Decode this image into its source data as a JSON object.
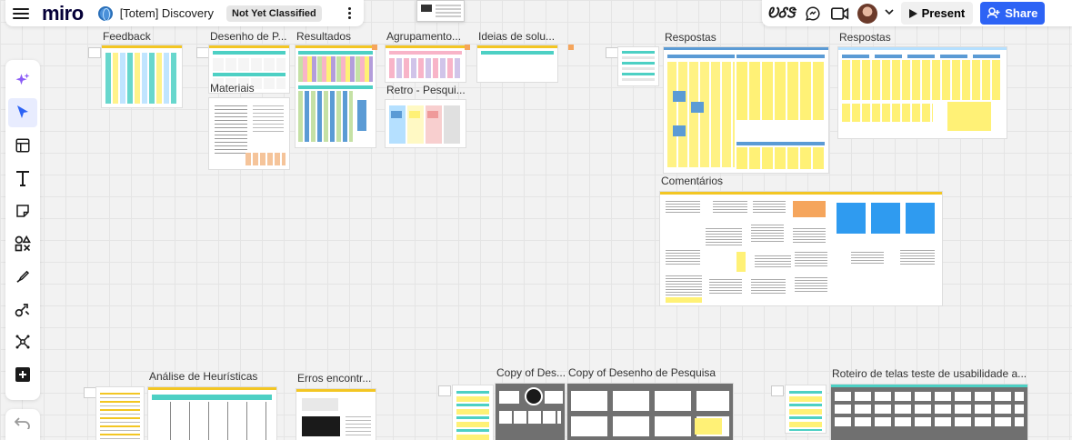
{
  "app": {
    "logo": "miro",
    "board_title": "[Totem] Discovery",
    "classification_badge": "Not Yet Classified"
  },
  "topbar": {
    "present_label": "Present",
    "share_label": "Share",
    "reactions_glyph": "ᎧᎴᏕ"
  },
  "colors": {
    "accent": "#2d63f5",
    "sticky_yellow": "#fff176",
    "sticky_teal": "#4dd0c4",
    "sticky_blue": "#5b9bd5",
    "sticky_pink": "#f8b4c8",
    "sticky_orange": "#f5a55c"
  },
  "toolbar": {
    "tools": [
      "sparkle-icon",
      "cursor-icon",
      "templates-icon",
      "text-icon",
      "sticky-note-icon",
      "shapes-icon",
      "pen-icon",
      "connectors-icon",
      "mindmap-icon",
      "add-icon"
    ]
  },
  "frames": {
    "feedback": "Feedback",
    "desenho": "Desenho de P...",
    "materiais": "Materiais",
    "resultados": "Resultados",
    "agrupamento": "Agrupamento...",
    "retro": "Retro - Pesqui...",
    "ideias": "Ideias de solu...",
    "respostas1": "Respostas",
    "respostas2": "Respostas",
    "comentarios": "Comentários",
    "heuristicas": "Análise de Heurísticas",
    "erros": "Erros encontr...",
    "copy_des": "Copy of Des...",
    "copy_desenho": "Copy of Desenho de Pesquisa",
    "roteiro": "Roteiro de telas teste de usabilidade a..."
  }
}
